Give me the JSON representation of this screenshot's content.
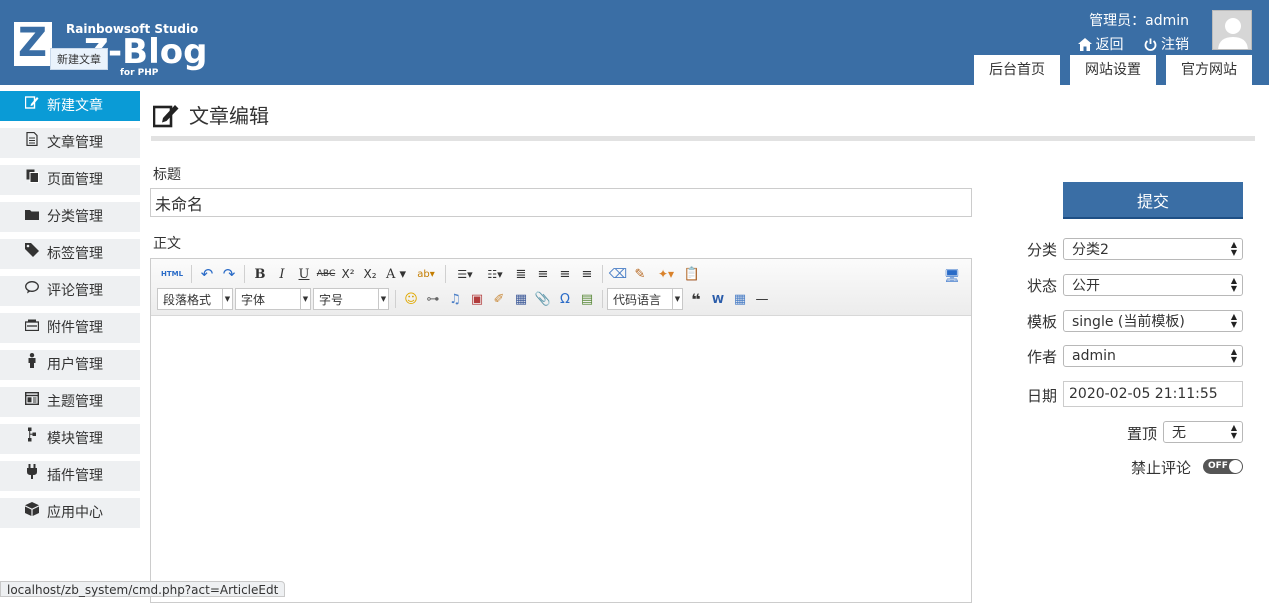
{
  "header": {
    "logo_studio": "Rainbowsoft Studio",
    "logo_brand": "Z-Blog",
    "logo_sub": "for PHP",
    "tooltip": "新建文章",
    "user_label": "管理员：",
    "user_name": "admin",
    "back_label": "返回",
    "logout_label": "注销",
    "tabs": [
      "后台首页",
      "网站设置",
      "官方网站"
    ],
    "bg_color": "#3a6ea5"
  },
  "sidebar": {
    "items": [
      {
        "label": "新建文章",
        "icon": "edit-icon"
      },
      {
        "label": "文章管理",
        "icon": "document-icon"
      },
      {
        "label": "页面管理",
        "icon": "pages-icon"
      },
      {
        "label": "分类管理",
        "icon": "folder-icon"
      },
      {
        "label": "标签管理",
        "icon": "tag-icon"
      },
      {
        "label": "评论管理",
        "icon": "comment-icon"
      },
      {
        "label": "附件管理",
        "icon": "attachment-icon"
      },
      {
        "label": "用户管理",
        "icon": "user-icon"
      },
      {
        "label": "主题管理",
        "icon": "theme-icon"
      },
      {
        "label": "模块管理",
        "icon": "module-icon"
      },
      {
        "label": "插件管理",
        "icon": "plugin-icon"
      },
      {
        "label": "应用中心",
        "icon": "app-center-icon"
      }
    ],
    "active_color": "#0a9bd6"
  },
  "main": {
    "page_title": "文章编辑",
    "title_label": "标题",
    "title_value": "未命名",
    "body_label": "正文",
    "editor": {
      "paragraph_format": "段落格式",
      "font": "字体",
      "font_size": "字号",
      "code_language": "代码语言",
      "html_label": "HTML"
    }
  },
  "side_panel": {
    "submit": "提交",
    "category_label": "分类",
    "category_value": "分类2",
    "status_label": "状态",
    "status_value": "公开",
    "template_label": "模板",
    "template_value": "single (当前模板)",
    "author_label": "作者",
    "author_value": "admin",
    "date_label": "日期",
    "date_value": "2020-02-05 21:11:55",
    "sticky_label": "置顶",
    "sticky_value": "无",
    "disable_comment_label": "禁止评论",
    "toggle_text": "OFF"
  },
  "status_bar": {
    "url": "localhost/zb_system/cmd.php?act=ArticleEdt"
  }
}
